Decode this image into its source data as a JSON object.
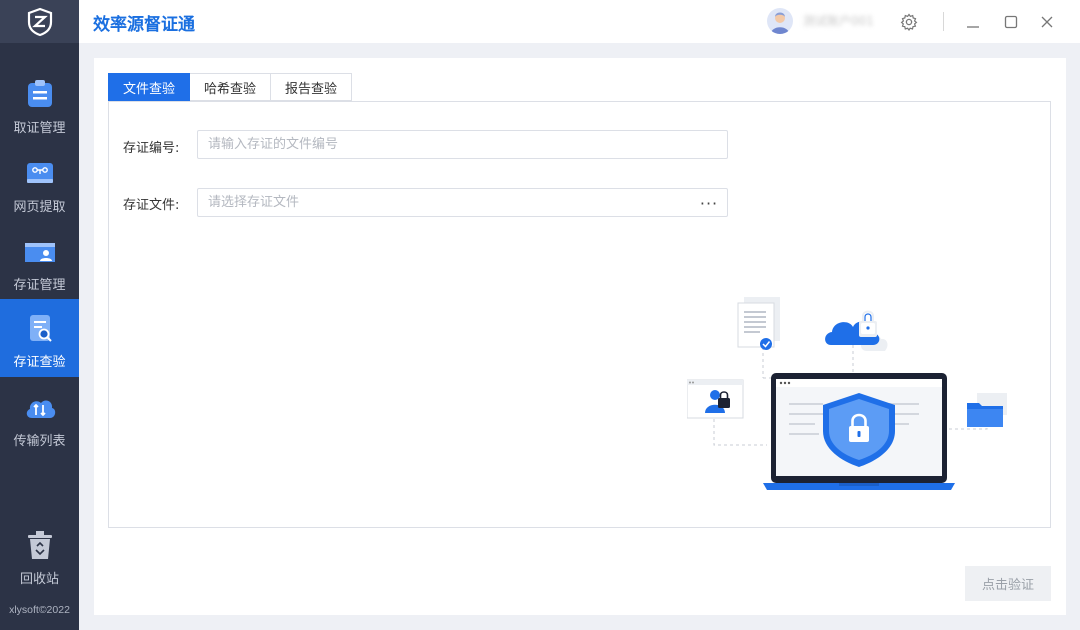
{
  "app": {
    "title": "效率源督证通",
    "username": "测试账户001",
    "copyright": "xlysoft©2022"
  },
  "sidebar": {
    "items": [
      {
        "label": "取证管理",
        "icon": "evidence-collect-icon",
        "active": false
      },
      {
        "label": "网页提取",
        "icon": "web-extract-icon",
        "active": false
      },
      {
        "label": "存证管理",
        "icon": "folder-user-icon",
        "active": false
      },
      {
        "label": "存证查验",
        "icon": "doc-search-icon",
        "active": true
      },
      {
        "label": "传输列表",
        "icon": "cloud-transfer-icon",
        "active": false
      }
    ],
    "recycle": {
      "label": "回收站",
      "icon": "trash-icon"
    }
  },
  "tabs": [
    {
      "label": "文件查验",
      "active": true
    },
    {
      "label": "哈希查验",
      "active": false
    },
    {
      "label": "报告查验",
      "active": false
    }
  ],
  "form": {
    "id_label": "存证编号:",
    "id_placeholder": "请输入存证的文件编号",
    "file_label": "存证文件:",
    "file_placeholder": "请选择存证文件",
    "browse_label": "···"
  },
  "verify_button": "点击验证",
  "colors": {
    "accent": "#1f6fe8",
    "sidebar_bg": "#2c3346",
    "sidebar_active": "#1f6dde"
  }
}
